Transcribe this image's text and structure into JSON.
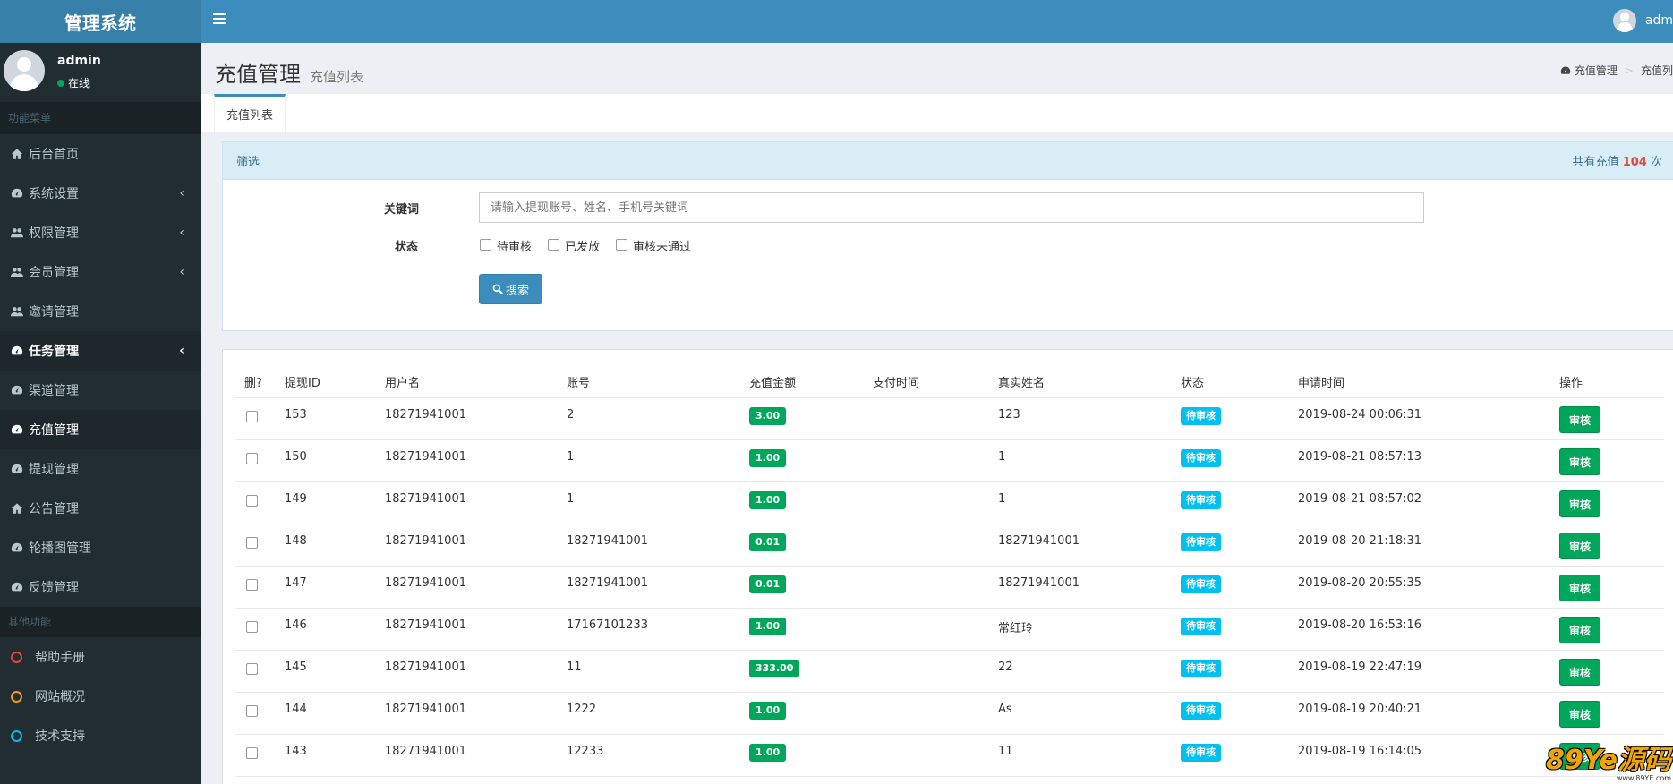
{
  "app": {
    "logo": "管理系统"
  },
  "header": {
    "user_name": "adm"
  },
  "sidebar": {
    "user": {
      "name": "admin",
      "status": "在线"
    },
    "section_main": "功能菜单",
    "items": [
      {
        "label": "后台首页",
        "icon": "home-icon"
      },
      {
        "label": "系统设置",
        "icon": "dashboard-icon"
      },
      {
        "label": "权限管理",
        "icon": "users-icon"
      },
      {
        "label": "会员管理",
        "icon": "users-icon"
      },
      {
        "label": "邀请管理",
        "icon": "users-icon"
      },
      {
        "label": "任务管理",
        "icon": "dashboard-icon"
      },
      {
        "label": "渠道管理",
        "icon": "dashboard-icon"
      },
      {
        "label": "充值管理",
        "icon": "dashboard-icon"
      },
      {
        "label": "提现管理",
        "icon": "dashboard-icon"
      },
      {
        "label": "公告管理",
        "icon": "home-icon"
      },
      {
        "label": "轮播图管理",
        "icon": "dashboard-icon"
      },
      {
        "label": "反馈管理",
        "icon": "dashboard-icon"
      }
    ],
    "section_other": "其他功能",
    "other_items": [
      {
        "label": "帮助手册",
        "color": "#dd4b39"
      },
      {
        "label": "网站概况",
        "color": "#f39c12"
      },
      {
        "label": "技术支持",
        "color": "#00c0ef"
      }
    ]
  },
  "page": {
    "title": "充值管理",
    "subtitle": "充值列表",
    "breadcrumb": [
      "充值管理",
      "充值列"
    ],
    "tab": "充值列表"
  },
  "filter": {
    "title": "筛选",
    "count_prefix": "共有充值",
    "count": "104",
    "count_suffix": "次",
    "keyword_label": "关键词",
    "keyword_placeholder": "请输入提现账号、姓名、手机号关键词",
    "status_label": "状态",
    "status_options": [
      "待审核",
      "已发放",
      "审核未通过"
    ],
    "search_label": "搜索"
  },
  "table": {
    "headers": [
      "删?",
      "提现ID",
      "用户名",
      "账号",
      "充值金额",
      "支付时间",
      "真实姓名",
      "状态",
      "申请时间",
      "操作"
    ],
    "rows": [
      {
        "id": "153",
        "user": "18271941001",
        "account": "2",
        "amount": "3.00",
        "pay_time": "",
        "name": "123",
        "status": "待审核",
        "time": "2019-08-24 00:06:31",
        "action": "审核"
      },
      {
        "id": "150",
        "user": "18271941001",
        "account": "1",
        "amount": "1.00",
        "pay_time": "",
        "name": "1",
        "status": "待审核",
        "time": "2019-08-21 08:57:13",
        "action": "审核"
      },
      {
        "id": "149",
        "user": "18271941001",
        "account": "1",
        "amount": "1.00",
        "pay_time": "",
        "name": "1",
        "status": "待审核",
        "time": "2019-08-21 08:57:02",
        "action": "审核"
      },
      {
        "id": "148",
        "user": "18271941001",
        "account": "18271941001",
        "amount": "0.01",
        "pay_time": "",
        "name": "18271941001",
        "status": "待审核",
        "time": "2019-08-20 21:18:31",
        "action": "审核"
      },
      {
        "id": "147",
        "user": "18271941001",
        "account": "18271941001",
        "amount": "0.01",
        "pay_time": "",
        "name": "18271941001",
        "status": "待审核",
        "time": "2019-08-20 20:55:35",
        "action": "审核"
      },
      {
        "id": "146",
        "user": "18271941001",
        "account": "17167101233",
        "amount": "1.00",
        "pay_time": "",
        "name": "常红玲",
        "status": "待审核",
        "time": "2019-08-20 16:53:16",
        "action": "审核"
      },
      {
        "id": "145",
        "user": "18271941001",
        "account": "11",
        "amount": "333.00",
        "pay_time": "",
        "name": "22",
        "status": "待审核",
        "time": "2019-08-19 22:47:19",
        "action": "审核"
      },
      {
        "id": "144",
        "user": "18271941001",
        "account": "1222",
        "amount": "1.00",
        "pay_time": "",
        "name": "As",
        "status": "待审核",
        "time": "2019-08-19 20:40:21",
        "action": "审核"
      },
      {
        "id": "143",
        "user": "18271941001",
        "account": "12233",
        "amount": "1.00",
        "pay_time": "",
        "name": "11",
        "status": "待审核",
        "time": "2019-08-19 16:14:05",
        "action": "审核"
      }
    ]
  },
  "watermark": {
    "main": "89Ye源码",
    "sub": "www.89YE.com"
  }
}
